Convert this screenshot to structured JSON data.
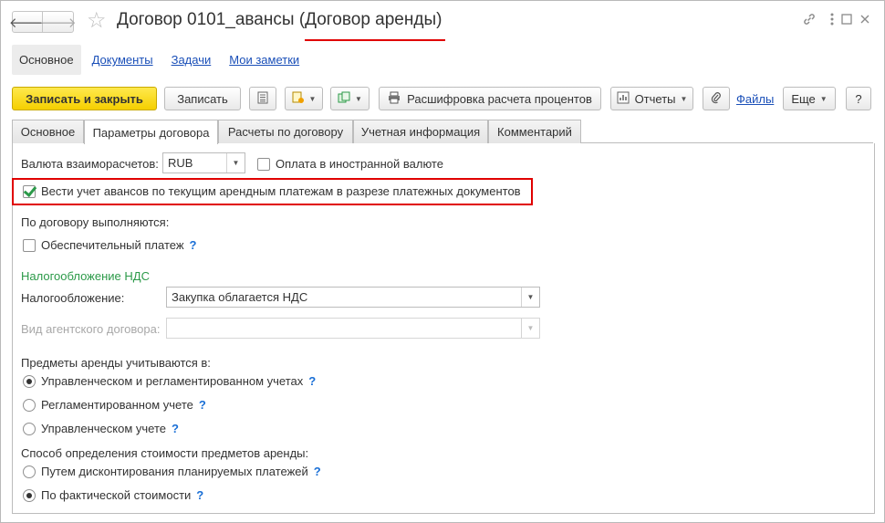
{
  "window": {
    "title_prefix": "Договор 0101_авансы",
    "title_suffix": "(Договор аренды)",
    "icons": [
      "link-icon",
      "more-icon",
      "maximize-icon",
      "close-icon"
    ]
  },
  "nav": {
    "back": "🡐",
    "forward": "🡒",
    "star": "☆"
  },
  "sections": [
    "Основное",
    "Документы",
    "Задачи",
    "Мои заметки"
  ],
  "toolbar": {
    "save_close": "Записать и закрыть",
    "save": "Записать",
    "calc_button": "Расшифровка расчета процентов",
    "reports": "Отчеты",
    "files": "Файлы",
    "more": "Еще",
    "help": "?"
  },
  "tabs": [
    "Основное",
    "Параметры договора",
    "Расчеты по договору",
    "Учетная информация",
    "Комментарий"
  ],
  "form": {
    "currency_label": "Валюта взаиморасчетов:",
    "currency_value": "RUB",
    "foreign_payment_label": "Оплата в иностранной валюте",
    "foreign_payment_checked": false,
    "advances_label": "Вести учет авансов по текущим арендным платежам в разрезе платежных документов",
    "advances_checked": true,
    "performed_header": "По договору выполняются:",
    "security_payment_label": "Обеспечительный платеж",
    "security_payment_checked": false,
    "vat_section": "Налогообложение НДС",
    "tax_label": "Налогообложение:",
    "tax_value": "Закупка облагается НДС",
    "agency_label": "Вид агентского договора:",
    "agency_value": "",
    "items_header": "Предметы аренды учитываются в:",
    "items_options": [
      {
        "label": "Управленческом и регламентированном учетах",
        "selected": true
      },
      {
        "label": "Регламентированном учете",
        "selected": false
      },
      {
        "label": "Управленческом учете",
        "selected": false
      }
    ],
    "cost_header": "Способ определения стоимости предметов аренды:",
    "cost_options": [
      {
        "label": "Путем дисконтирования планируемых платежей",
        "selected": false
      },
      {
        "label": "По фактической стоимости",
        "selected": true
      }
    ],
    "help_mark": "?"
  }
}
